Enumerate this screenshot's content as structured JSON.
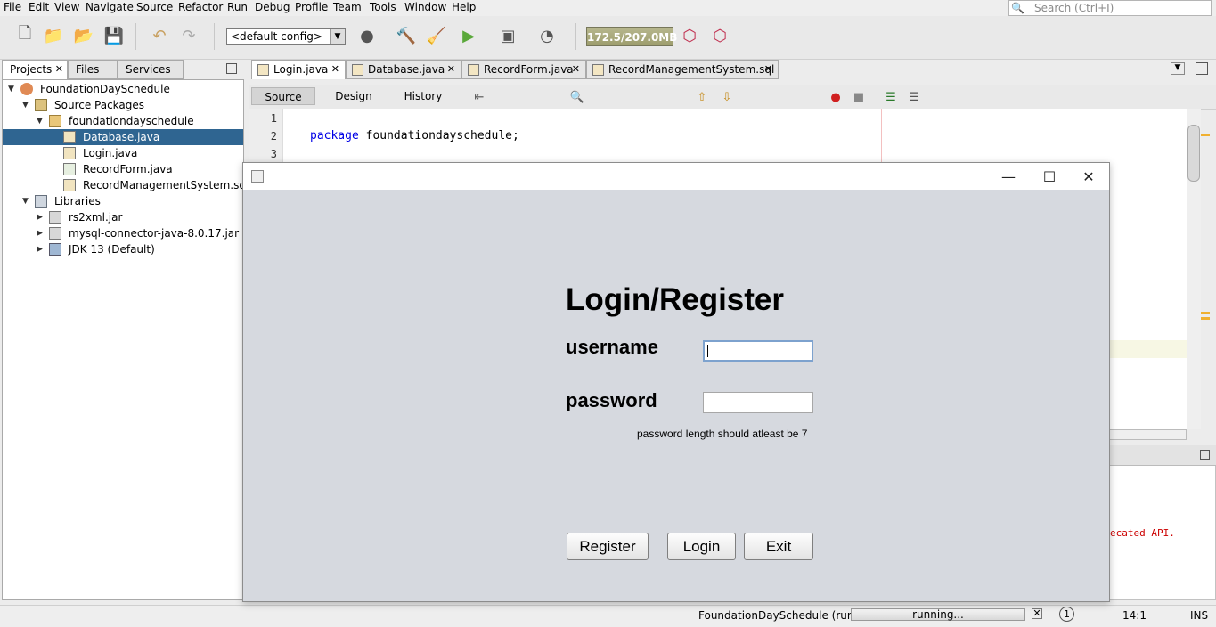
{
  "menu": [
    "File",
    "Edit",
    "View",
    "Navigate",
    "Source",
    "Refactor",
    "Run",
    "Debug",
    "Profile",
    "Team",
    "Tools",
    "Window",
    "Help"
  ],
  "search": {
    "placeholder": "Search (Ctrl+I)"
  },
  "toolbar": {
    "config": "<default config>",
    "memory": "172.5/207.0MB"
  },
  "left_tabs": [
    "Projects",
    "Files",
    "Services"
  ],
  "tree": {
    "project": "FoundationDaySchedule",
    "source_packages": "Source Packages",
    "package": "foundationdayschedule",
    "files": [
      "Database.java",
      "Login.java",
      "RecordForm.java",
      "RecordManagementSystem.sql"
    ],
    "libraries": "Libraries",
    "libs": [
      "rs2xml.jar",
      "mysql-connector-java-8.0.17.jar",
      "JDK 13 (Default)"
    ]
  },
  "editor_tabs": [
    "Login.java",
    "Database.java",
    "RecordForm.java",
    "RecordManagementSystem.sql"
  ],
  "view_tabs": [
    "Source",
    "Design",
    "History"
  ],
  "code": {
    "lines": [
      "1",
      "2",
      "3"
    ],
    "keyword": "package",
    "rest": "foundationdayschedule;"
  },
  "output_text": "ecated API.",
  "status": {
    "project": "FoundationDaySchedule (run)",
    "progress": "running...",
    "notifications": "1",
    "position": "14:1",
    "mode": "INS"
  },
  "dialog": {
    "heading": "Login/Register",
    "username_label": "username",
    "password_label": "password",
    "hint": "password length should atleast be 7",
    "register": "Register",
    "login": "Login",
    "exit": "Exit"
  }
}
